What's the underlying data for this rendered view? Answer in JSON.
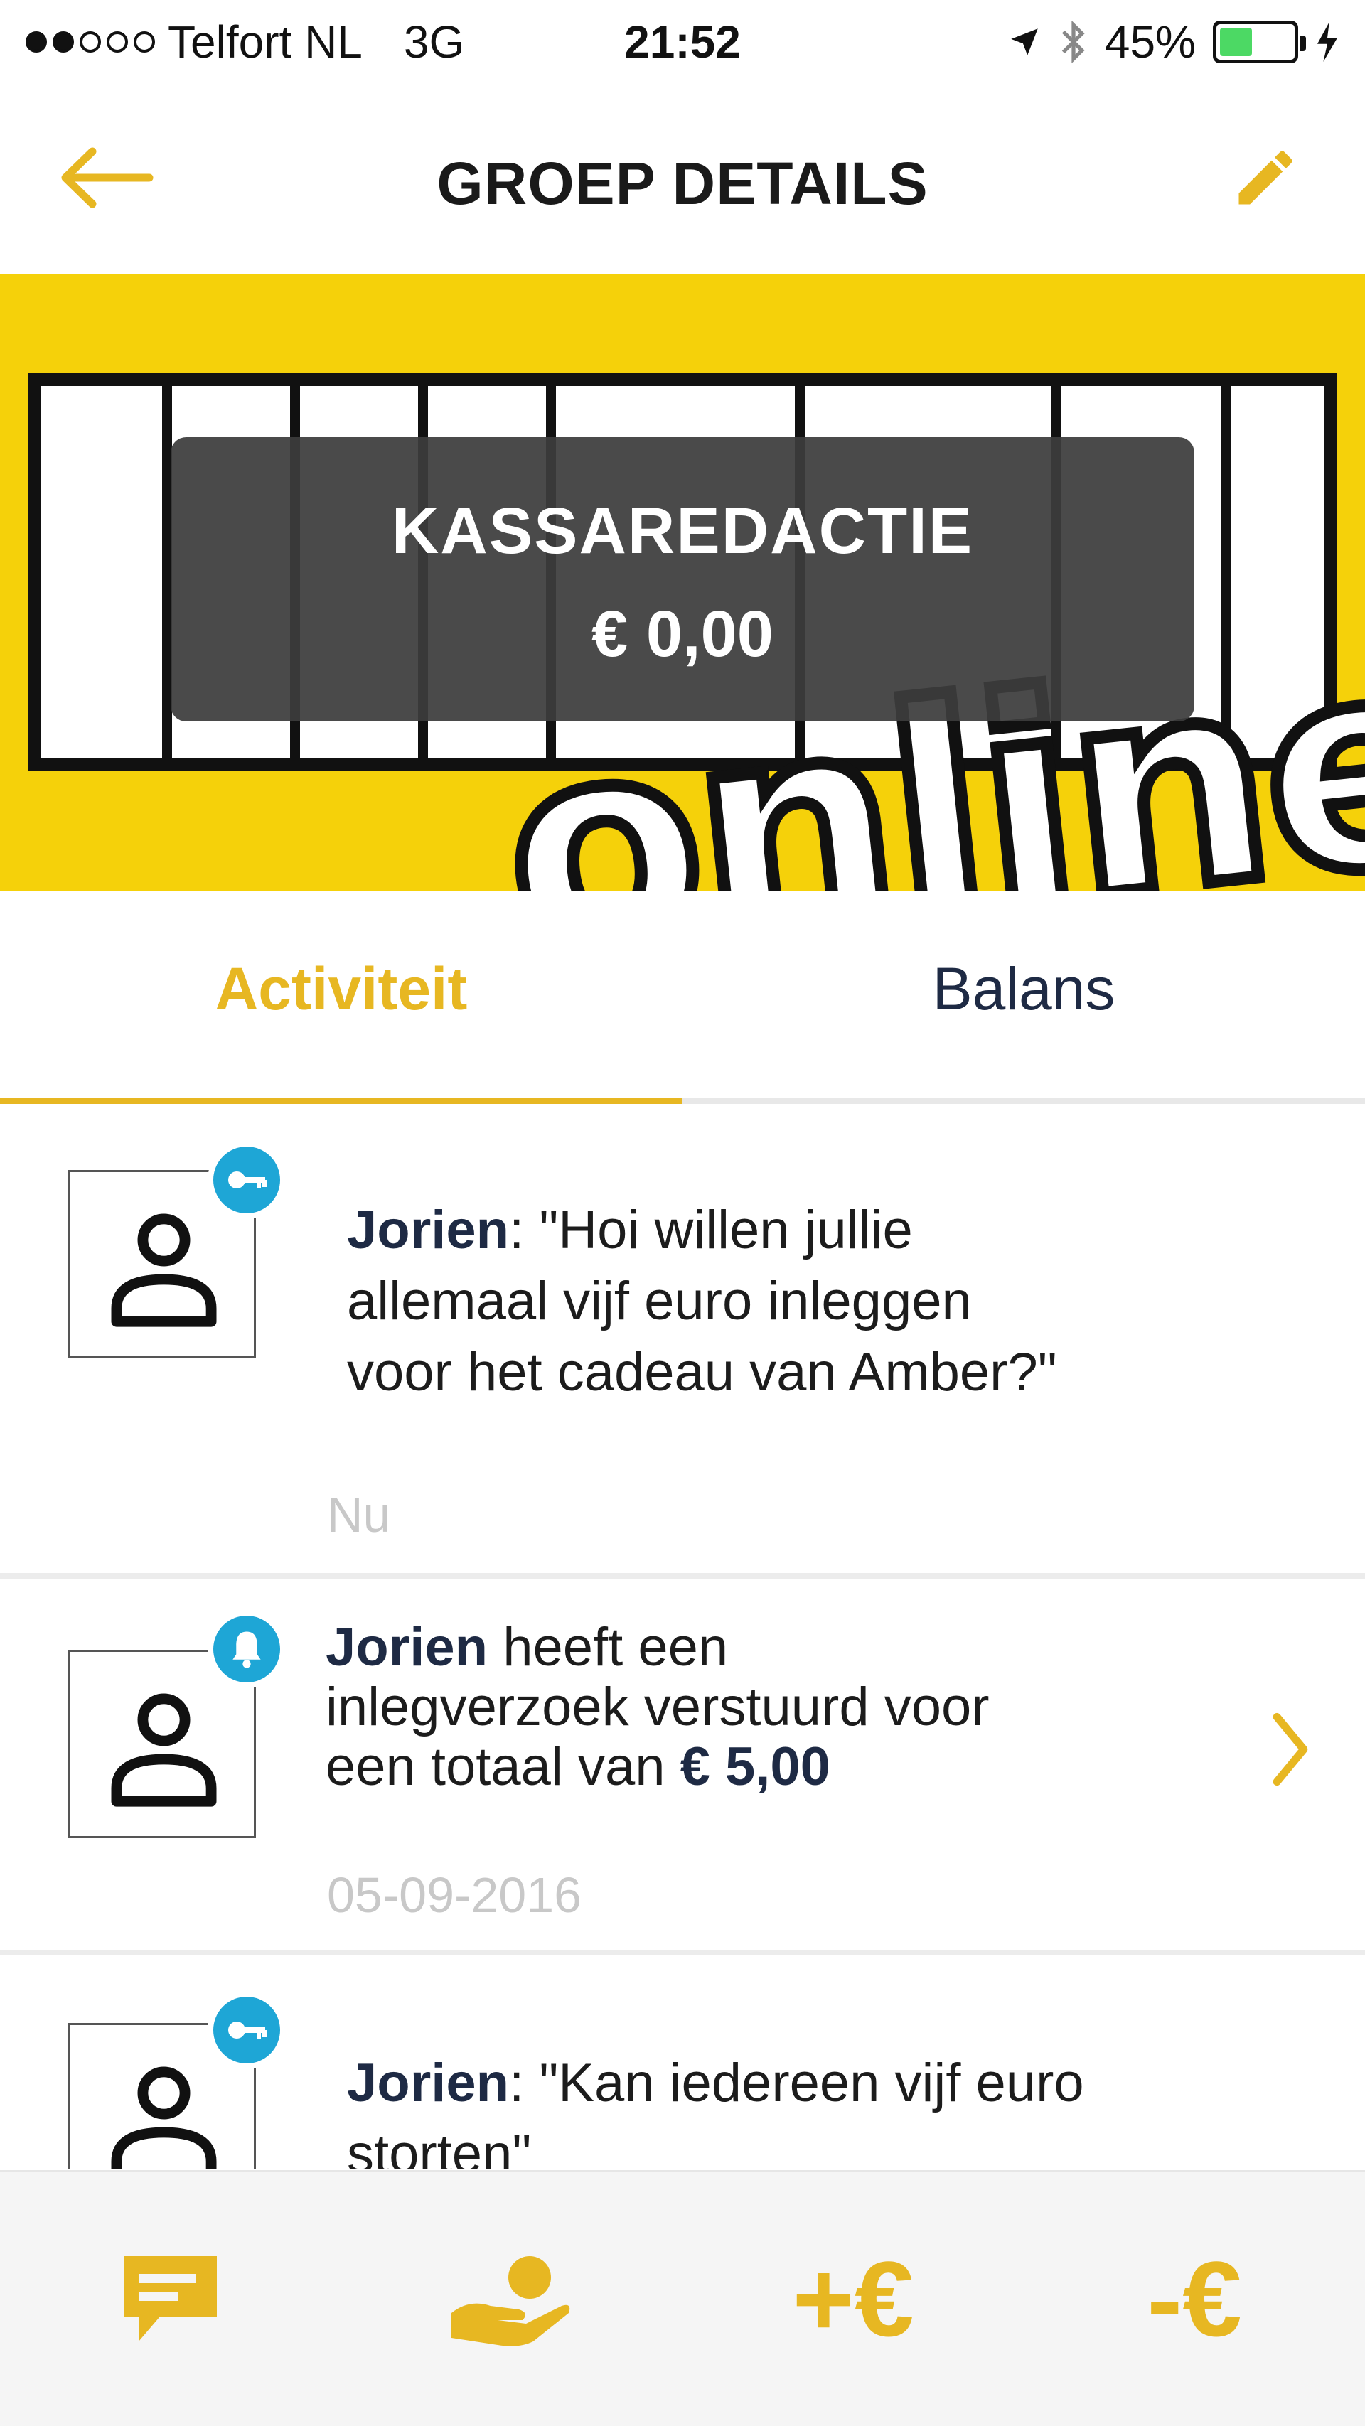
{
  "status_bar": {
    "carrier": "Telfort NL",
    "network": "3G",
    "time": "21:52",
    "battery_percent": "45%",
    "signal_strength": 2,
    "signal_max": 5,
    "battery_level": 0.45
  },
  "header": {
    "title": "GROEP DETAILS",
    "back_icon": "arrow-left-icon",
    "edit_icon": "pencil-icon"
  },
  "group": {
    "name": "KASSAREDACTIE",
    "balance": "€ 0,00",
    "banner_text": "online"
  },
  "tabs": [
    {
      "label": "Activiteit",
      "active": true
    },
    {
      "label": "Balans",
      "active": false
    }
  ],
  "feed": [
    {
      "badge_icon": "key-icon",
      "author": "Jorien",
      "separator": ": ",
      "message_lines": [
        "\"Hoi willen jullie",
        "allemaal vijf euro inleggen",
        "voor het cadeau van Amber?\""
      ],
      "time": "Nu"
    },
    {
      "badge_icon": "bell-icon",
      "author": "Jorien",
      "text_line1_rest": " heeft een",
      "text_line2": "inlegverzoek verstuurd voor",
      "text_line3_prefix": "een totaal van ",
      "amount": "€ 5,00",
      "time": "05-09-2016",
      "chevron_icon": "chevron-right-icon"
    },
    {
      "badge_icon": "key-icon",
      "author": "Jorien",
      "separator": ": ",
      "message_lines": [
        "\"Kan iedereen vijf euro",
        "storten\""
      ]
    }
  ],
  "bottom_bar": {
    "chat_icon": "chat-icon",
    "collect_icon": "hand-coin-icon",
    "add_label": "+€",
    "subtract_label": "-€"
  },
  "colors": {
    "accent": "#e7b722",
    "banner_yellow": "#f5d10a",
    "badge_blue": "#1ea6d6",
    "text_dark": "#1e2a44",
    "muted": "#c8c8c8"
  }
}
